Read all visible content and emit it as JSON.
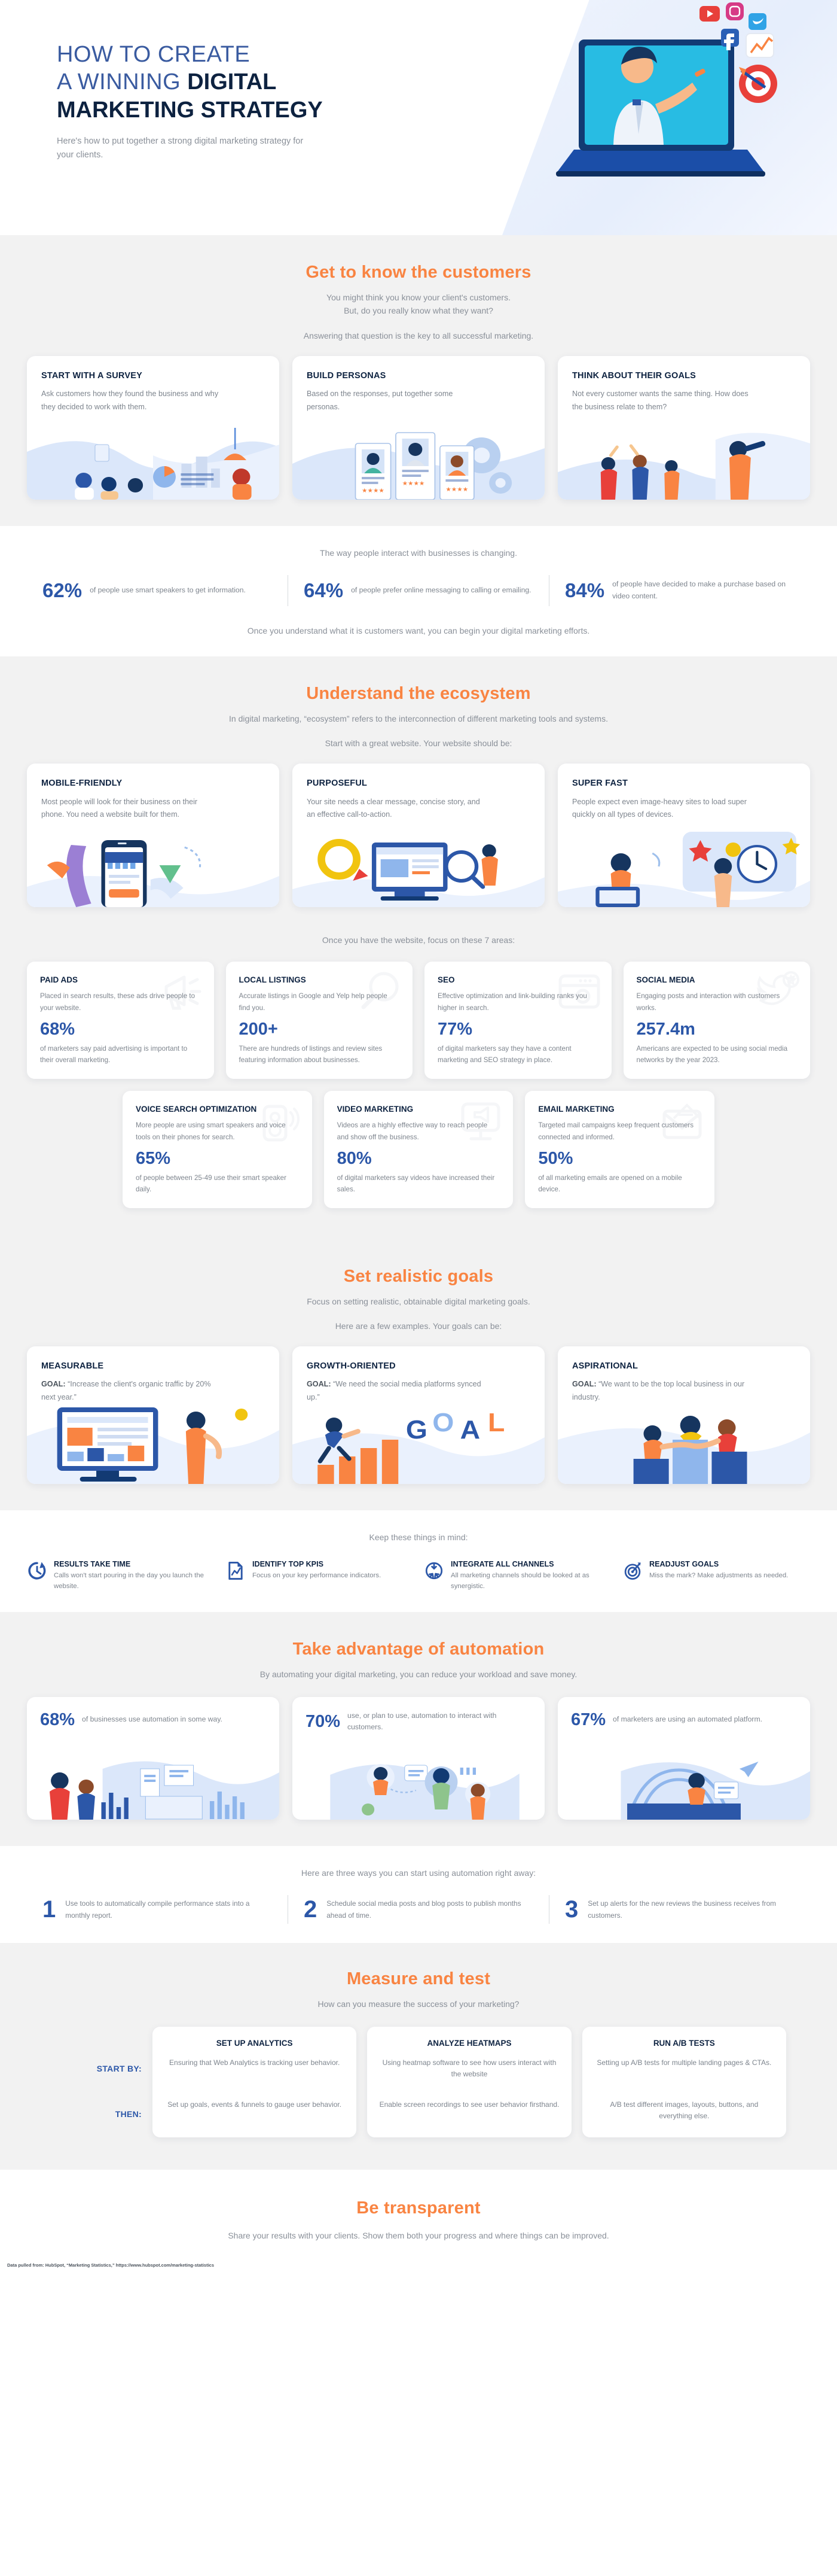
{
  "hero": {
    "title_line1": "HOW TO CREATE",
    "title_line2a": "A WINNING ",
    "title_line2b": "DIGITAL",
    "title_line3": "MARKETING STRATEGY",
    "subtitle": "Here's how to put together a strong digital marketing strategy for your clients."
  },
  "colors": {
    "accent_orange": "#f98442",
    "navy": "#0d2240",
    "blue": "#2c57a8",
    "muted": "#8a9099",
    "section_grey": "#f2f2f2"
  },
  "section_customers": {
    "title": "Get to know the customers",
    "sub_line1": "You might think you know your client's customers.",
    "sub_line2": "But, do you really know what they want?",
    "sub_line3": "Answering that question is the key to all successful marketing.",
    "cards": [
      {
        "title": "START WITH A SURVEY",
        "body": "Ask customers how they found the business and why they decided to work with them."
      },
      {
        "title": "BUILD PERSONAS",
        "body": "Based on the responses, put together some personas."
      },
      {
        "title": "THINK ABOUT THEIR GOALS",
        "body": "Not every customer wants the same thing. How does the business relate to them?"
      }
    ],
    "stats_intro": "The way people interact with businesses is changing.",
    "stats": [
      {
        "number": "62%",
        "text": "of people use smart speakers to get information."
      },
      {
        "number": "64%",
        "text": "of people prefer online messaging to calling or emailing."
      },
      {
        "number": "84%",
        "text": "of people have decided to make a purchase based on video content."
      }
    ],
    "outro": "Once you understand what it is customers want, you can begin your digital marketing efforts."
  },
  "section_ecosystem": {
    "title": "Understand the ecosystem",
    "sub_line1": "In digital marketing, “ecosystem” refers to the interconnection of different marketing tools and systems.",
    "sub_line2": "Start with a great website. Your website should be:",
    "cards": [
      {
        "title": "MOBILE-FRIENDLY",
        "body": "Most people will look for their business on their phone. You need a website built for them."
      },
      {
        "title": "PURPOSEFUL",
        "body": "Your site needs a clear message, concise story, and an effective call-to-action."
      },
      {
        "title": "SUPER FAST",
        "body": "People expect even image-heavy sites to load super quickly on all types of devices."
      }
    ],
    "areas_intro": "Once you have the website, focus on these 7 areas:",
    "areas_row1": [
      {
        "title": "PAID ADS",
        "body": "Placed in search results, these ads drive people to your website.",
        "stat": "68%",
        "stat_text": "of marketers say paid advertising is important to their overall marketing.",
        "icon": "megaphone-icon"
      },
      {
        "title": "LOCAL LISTINGS",
        "body": "Accurate listings in Google and Yelp help people find you.",
        "stat": "200+",
        "stat_text": "There are hundreds of listings and review sites featuring information about businesses.",
        "icon": "magnifier-icon"
      },
      {
        "title": "SEO",
        "body": "Effective optimization and link-building ranks you higher in search.",
        "stat": "77%",
        "stat_text": "of digital marketers say they have a content marketing and SEO strategy in place.",
        "icon": "browser-search-icon"
      },
      {
        "title": "SOCIAL MEDIA",
        "body": "Engaging posts and interaction with customers works.",
        "stat": "257.4m",
        "stat_text": "Americans are expected to be using social media networks by the year 2023.",
        "icon": "bird-icon"
      }
    ],
    "areas_row2": [
      {
        "title": "VOICE SEARCH OPTIMIZATION",
        "body": "More people are using smart speakers and voice tools on their phones for search.",
        "stat": "65%",
        "stat_text": "of people between 25-49 use their smart speaker daily.",
        "icon": "smart-speaker-icon"
      },
      {
        "title": "VIDEO MARKETING",
        "body": "Videos are a highly effective way to reach people and show off the business.",
        "stat": "80%",
        "stat_text": "of digital marketers say videos have increased their sales.",
        "icon": "video-screen-icon"
      },
      {
        "title": "EMAIL MARKETING",
        "body": "Targeted mail campaigns keep frequent customers connected and informed.",
        "stat": "50%",
        "stat_text": "of all marketing emails are opened on a mobile device.",
        "icon": "envelope-icon"
      }
    ]
  },
  "section_goals": {
    "title": "Set realistic goals",
    "sub_line1": "Focus on setting realistic, obtainable digital marketing goals.",
    "sub_line2": "Here are a few examples. Your goals can be:",
    "cards": [
      {
        "title": "MEASURABLE",
        "label": "GOAL:",
        "quote": " “Increase the client's organic traffic by 20% next year.”"
      },
      {
        "title": "GROWTH-ORIENTED",
        "label": "GOAL:",
        "quote": " “We need the social media platforms synced up.”"
      },
      {
        "title": "ASPIRATIONAL",
        "label": "GOAL:",
        "quote": " “We want to be the top local business in our industry."
      }
    ],
    "mind_intro": "Keep these things in mind:",
    "mind_items": [
      {
        "icon": "clock-arrow-icon",
        "title": "RESULTS TAKE TIME",
        "body": "Calls won't start pouring in the day you launch the website."
      },
      {
        "icon": "chart-document-icon",
        "title": "IDENTIFY TOP KPIs",
        "body": "Focus on your key performance indicators."
      },
      {
        "icon": "converge-arrows-icon",
        "title": "INTEGRATE ALL CHANNELS",
        "body": "All marketing channels should be looked at as synergistic."
      },
      {
        "icon": "target-dart-icon",
        "title": "READJUST GOALS",
        "body": "Miss the mark? Make adjustments as needed."
      }
    ]
  },
  "section_automation": {
    "title": "Take advantage of automation",
    "sub_line1": "By automating your digital marketing, you can reduce your workload and save money.",
    "cards": [
      {
        "number": "68%",
        "text": "of businesses use automation in some way."
      },
      {
        "number": "70%",
        "text": "use, or plan to use, automation to interact with customers."
      },
      {
        "number": "67%",
        "text": "of marketers are using an automated platform."
      }
    ],
    "ways_intro": "Here are three ways you can start using automation right away:",
    "ways": [
      {
        "n": "1",
        "text": "Use tools to automatically compile performance stats into a monthly report."
      },
      {
        "n": "2",
        "text": "Schedule social media posts and blog posts to publish months ahead of time."
      },
      {
        "n": "3",
        "text": "Set up alerts for the new reviews the business receives from customers."
      }
    ]
  },
  "section_measure": {
    "title": "Measure and test",
    "sub_line1": "How can you measure the success of your marketing?",
    "label_start": "START BY:",
    "label_then": "THEN:",
    "columns": [
      {
        "title": "SET UP ANALYTICS",
        "start": "Ensuring that Web Analytics is tracking user behavior.",
        "then": "Set up goals, events & funnels to gauge user behavior."
      },
      {
        "title": "ANALYZE HEATMAPS",
        "start": "Using heatmap software to see how users interact with the website",
        "then": "Enable screen recordings to see user behavior firsthand."
      },
      {
        "title": "RUN A/B TESTS",
        "start": "Setting up A/B tests for multiple landing pages & CTAs.",
        "then": "A/B test different images, layouts, buttons, and everything else."
      }
    ]
  },
  "section_transparent": {
    "title": "Be transparent",
    "sub_line1": "Share your results with your clients. Show them both your progress and where things can be improved."
  },
  "footnote": "Data pulled from: HubSpot, “Marketing Statistics,” https://www.hubspot.com/marketing-statistics"
}
